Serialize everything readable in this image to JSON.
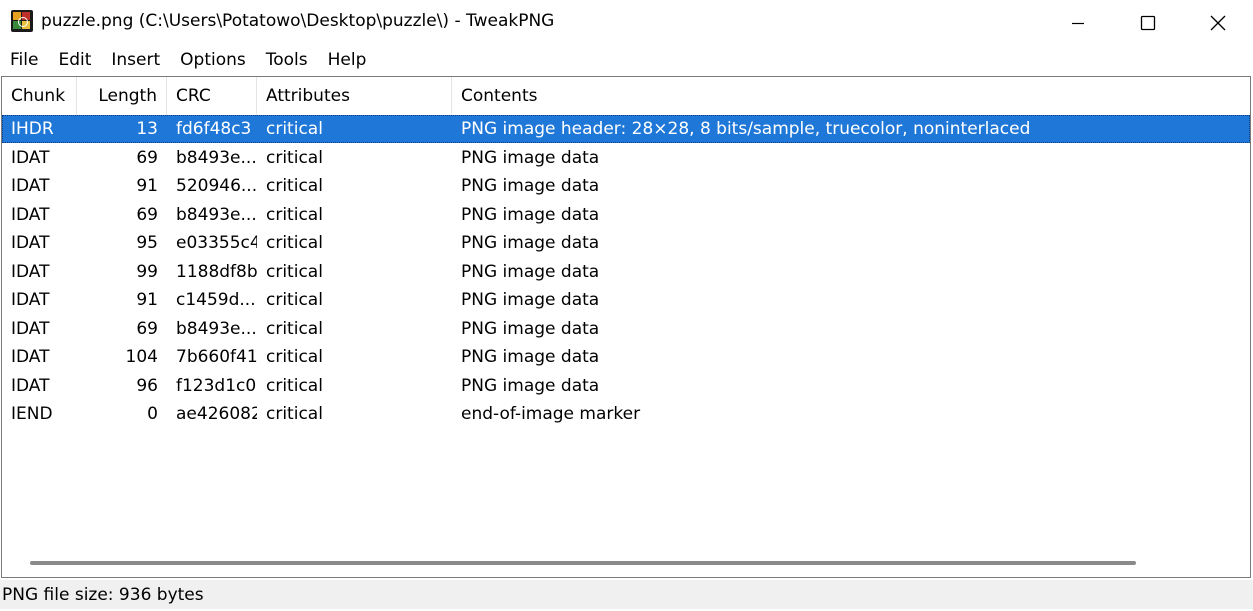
{
  "window": {
    "title": "puzzle.png (C:\\Users\\Potatowo\\Desktop\\puzzle\\) - TweakPNG",
    "app_icon": "tweakpng-icon",
    "controls": [
      "minimize-icon",
      "maximize-icon",
      "close-icon"
    ]
  },
  "menu": {
    "items": [
      {
        "label": "File"
      },
      {
        "label": "Edit"
      },
      {
        "label": "Insert"
      },
      {
        "label": "Options"
      },
      {
        "label": "Tools"
      },
      {
        "label": "Help"
      }
    ]
  },
  "list": {
    "columns": {
      "chunk": "Chunk",
      "length": "Length",
      "crc": "CRC",
      "attributes": "Attributes",
      "contents": "Contents"
    },
    "rows": [
      {
        "chunk": "IHDR",
        "length": "13",
        "crc": "fd6f48c3",
        "attributes": "critical",
        "contents": "PNG image header: 28×28, 8 bits/sample, truecolor, noninterlaced",
        "selected": true
      },
      {
        "chunk": "IDAT",
        "length": "69",
        "crc": "b8493e...",
        "attributes": "critical",
        "contents": "PNG image data"
      },
      {
        "chunk": "IDAT",
        "length": "91",
        "crc": "520946...",
        "attributes": "critical",
        "contents": "PNG image data"
      },
      {
        "chunk": "IDAT",
        "length": "69",
        "crc": "b8493e...",
        "attributes": "critical",
        "contents": "PNG image data"
      },
      {
        "chunk": "IDAT",
        "length": "95",
        "crc": "e03355c4",
        "attributes": "critical",
        "contents": "PNG image data"
      },
      {
        "chunk": "IDAT",
        "length": "99",
        "crc": "1188df8b",
        "attributes": "critical",
        "contents": "PNG image data"
      },
      {
        "chunk": "IDAT",
        "length": "91",
        "crc": "c1459d...",
        "attributes": "critical",
        "contents": "PNG image data"
      },
      {
        "chunk": "IDAT",
        "length": "69",
        "crc": "b8493e...",
        "attributes": "critical",
        "contents": "PNG image data"
      },
      {
        "chunk": "IDAT",
        "length": "104",
        "crc": "7b660f41",
        "attributes": "critical",
        "contents": "PNG image data"
      },
      {
        "chunk": "IDAT",
        "length": "96",
        "crc": "f123d1c0",
        "attributes": "critical",
        "contents": "PNG image data"
      },
      {
        "chunk": "IEND",
        "length": "0",
        "crc": "ae426082",
        "attributes": "critical",
        "contents": "end-of-image marker"
      }
    ]
  },
  "status": {
    "text": "PNG file size: 936 bytes"
  },
  "colors": {
    "selection": "#1f78d8",
    "status_bg": "#f0f0f0"
  }
}
